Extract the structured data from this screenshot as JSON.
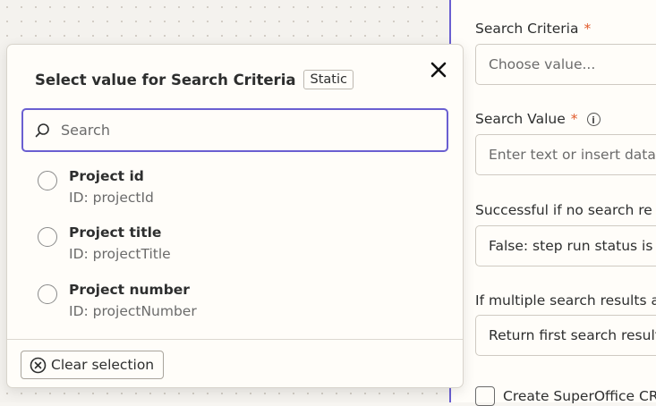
{
  "modal": {
    "title": "Select value for Search Criteria",
    "badge": "Static",
    "search_placeholder": "Search",
    "options": [
      {
        "label": "Project id",
        "id": "ID: projectId"
      },
      {
        "label": "Project title",
        "id": "ID: projectTitle"
      },
      {
        "label": "Project number",
        "id": "ID: projectNumber"
      }
    ],
    "clear_label": "Clear selection"
  },
  "form": {
    "search_criteria_label": "Search Criteria",
    "search_criteria_placeholder": "Choose value...",
    "search_value_label": "Search Value",
    "search_value_placeholder": "Enter text or insert data...",
    "success_label": "Successful if no search re",
    "success_value": "False: step run status is",
    "multiple_label": "If multiple search results a",
    "multiple_value": "Return first search result",
    "checkbox_label": "Create SuperOffice CR",
    "required_mark": "*"
  },
  "colors": {
    "accent": "#6a5fd1",
    "required": "#e15a2b"
  }
}
